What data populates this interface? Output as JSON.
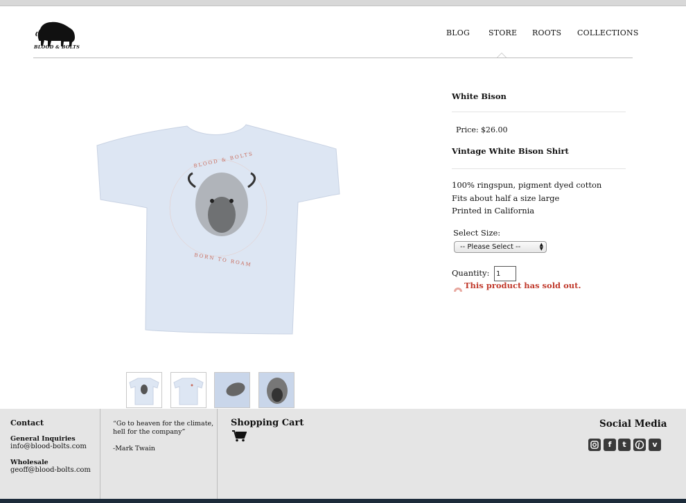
{
  "brand": {
    "logo_text": "BLOOD & BOLTS"
  },
  "nav": {
    "items": [
      "BLOG",
      "STORE",
      "ROOTS",
      "COLLECTIONS"
    ],
    "active": "STORE"
  },
  "product": {
    "title": "White Bison",
    "price": "Price: $26.00",
    "subtitle": "Vintage White Bison Shirt",
    "details": [
      "100% ringspun, pigment dyed cotton",
      "Fits about half a size large",
      "Printed in California"
    ],
    "size_label": "Select Size:",
    "size_selected": "-- Please Select --",
    "quantity_label": "Quantity:",
    "quantity_value": "1",
    "sold_out_message": "This product has sold out.",
    "shirt_print_top": "BLOOD & BOLTS",
    "shirt_print_bottom": "BORN TO ROAM",
    "shirt_color": "#dde6f3",
    "print_accent": "#c86a5a"
  },
  "footer": {
    "contact_heading": "Contact",
    "general_label": "General Inquiries",
    "general_email": "info@blood-bolts.com",
    "wholesale_label": "Wholesale",
    "wholesale_email": "geoff@blood-bolts.com",
    "quote_line1": "“Go to heaven for the climate,",
    "quote_line2": "hell for the company”",
    "quote_author": "-Mark Twain",
    "cart_heading": "Shopping Cart",
    "social_heading": "Social Media",
    "social_icons": [
      "instagram-icon",
      "facebook-icon",
      "tumblr-icon",
      "pinterest-icon",
      "vimeo-icon"
    ]
  },
  "colors": {
    "sold_out": "#c0392b",
    "footer_bg": "#e5e5e5",
    "footer_strip": "#1c2b3a"
  }
}
